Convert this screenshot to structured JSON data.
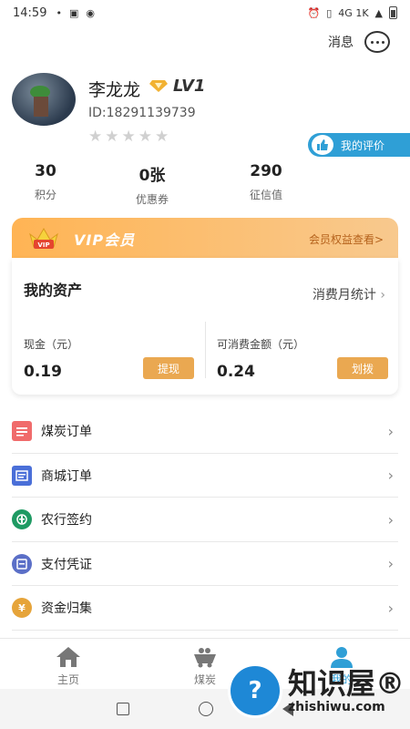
{
  "status_bar": {
    "time": "14:59",
    "network_text": "4G 1K"
  },
  "header": {
    "messages_label": "消息"
  },
  "profile": {
    "name": "李龙龙",
    "level": "LV1",
    "id_text": "ID:18291139739",
    "rating_stars": 0,
    "rating_max": 5,
    "my_review_label": "我的评价"
  },
  "stats": [
    {
      "value": "30",
      "label": "积分"
    },
    {
      "value": "0张",
      "label": "优惠券"
    },
    {
      "value": "290",
      "label": "征信值"
    }
  ],
  "vip": {
    "badge_text": "VIP",
    "title": "VIP会员",
    "link": "会员权益查看>"
  },
  "assets": {
    "title": "我的资产",
    "monthly_stats_link": "消费月统计",
    "cash": {
      "label": "现金（元）",
      "value": "0.19",
      "button": "提现"
    },
    "spendable": {
      "label": "可消费金额（元）",
      "value": "0.24",
      "button": "划拨"
    }
  },
  "menu": [
    {
      "label": "煤炭订单",
      "icon": "coal-order-icon",
      "color": "#f06b6b"
    },
    {
      "label": "商城订单",
      "icon": "mall-order-icon",
      "color": "#4a6fd8"
    },
    {
      "label": "农行签约",
      "icon": "abc-bank-icon",
      "color": "#1f9a63"
    },
    {
      "label": "支付凭证",
      "icon": "payment-voucher-icon",
      "color": "#5b6fc7"
    },
    {
      "label": "资金归集",
      "icon": "fund-collection-icon",
      "color": "#e6a43a"
    }
  ],
  "tabbar": [
    {
      "label": "主页",
      "icon": "home-icon"
    },
    {
      "label": "煤炭",
      "icon": "coal-cart-icon"
    },
    {
      "label": "我的",
      "icon": "profile-icon"
    }
  ],
  "watermark": {
    "cn": "知识屋®",
    "en": "zhishiwu.com"
  },
  "colors": {
    "accent": "#2f9fd6",
    "vip_orange": "#ffb454",
    "asset_button": "#eaa851"
  }
}
